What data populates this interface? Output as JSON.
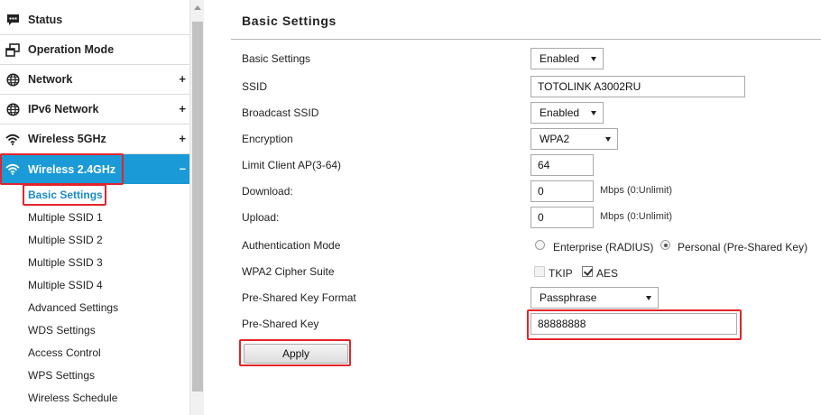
{
  "sidebar": {
    "items": [
      {
        "label": "Status",
        "icon": "chat-bubble-icon"
      },
      {
        "label": "Operation Mode",
        "icon": "windows-icon"
      },
      {
        "label": "Network",
        "icon": "globe-icon",
        "expand": "+"
      },
      {
        "label": "IPv6 Network",
        "icon": "globe-icon",
        "expand": "+"
      },
      {
        "label": "Wireless 5GHz",
        "icon": "wifi-icon",
        "expand": "+"
      },
      {
        "label": "Wireless 2.4GHz",
        "icon": "wifi-icon",
        "expand": "–"
      }
    ],
    "subitems": [
      "Basic Settings",
      "Multiple SSID 1",
      "Multiple SSID 2",
      "Multiple SSID 3",
      "Multiple SSID 4",
      "Advanced Settings",
      "WDS Settings",
      "Access Control",
      "WPS Settings",
      "Wireless Schedule"
    ],
    "active_color": "#1a9ad6"
  },
  "main": {
    "title": "Basic Settings",
    "basic_settings": {
      "label": "Basic Settings",
      "value": "Enabled"
    },
    "ssid": {
      "label": "SSID",
      "value": "TOTOLINK A3002RU"
    },
    "broadcast_ssid": {
      "label": "Broadcast SSID",
      "value": "Enabled"
    },
    "encryption": {
      "label": "Encryption",
      "value": "WPA2"
    },
    "limit_client": {
      "label": "Limit Client AP(3-64)",
      "value": "64"
    },
    "download": {
      "label": "Download:",
      "value": "0",
      "unit": "Mbps (0:Unlimit)"
    },
    "upload": {
      "label": "Upload:",
      "value": "0",
      "unit": "Mbps (0:Unlimit)"
    },
    "auth_mode": {
      "label": "Authentication Mode",
      "option_enterprise": "Enterprise (RADIUS)",
      "option_personal": "Personal (Pre-Shared Key)",
      "selected": "personal"
    },
    "cipher": {
      "label": "WPA2 Cipher Suite",
      "tkip": "TKIP",
      "aes": "AES"
    },
    "psk_format": {
      "label": "Pre-Shared Key Format",
      "value": "Passphrase"
    },
    "psk": {
      "label": "Pre-Shared Key",
      "value": "88888888"
    },
    "apply_label": "Apply"
  },
  "highlight_color": "#e4242b"
}
